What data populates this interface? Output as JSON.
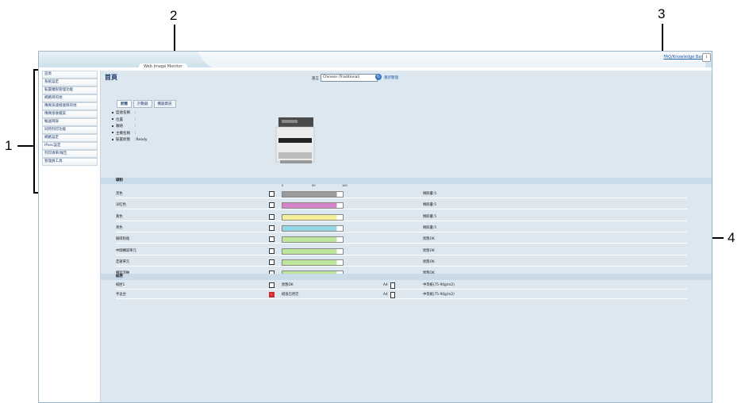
{
  "callouts": {
    "c1": "1",
    "c2": "2",
    "c3": "3",
    "c4": "4"
  },
  "header": {
    "brand": "Web Image Monitor",
    "faq": "FAQ/Knowledge Base",
    "help_icon": "help-icon"
  },
  "sidebar": {
    "items": [
      "首頁",
      "系統設定",
      "裝置權限管理功能",
      "網路目的地",
      "傳真快速撥號目的地",
      "傳真接收檔案",
      "輸送目錄",
      "同時列印功能",
      "網路設定",
      "IPsec設定",
      "列印清單/報告",
      "管理員工具"
    ]
  },
  "main": {
    "title": "首頁",
    "language_label": "語言",
    "language_value": "Chinese (Traditional)",
    "refresh_label": "重新整理",
    "tabs": [
      "狀態",
      "計數器",
      "機器資訊"
    ],
    "info": [
      {
        "label": "型號名稱",
        "value": ":"
      },
      {
        "label": "位置",
        "value": ":"
      },
      {
        "label": "聯絡",
        "value": ":"
      },
      {
        "label": "主機名稱",
        "value": ":"
      },
      {
        "label": "裝置狀態",
        "value": ":Ready"
      }
    ],
    "toner_section": "碳粉",
    "scale": [
      "0",
      "50",
      "100"
    ],
    "toner": [
      {
        "name": "黑色",
        "status": "剩餘量:5",
        "color": "#9a9a9a",
        "level": 0.9
      },
      {
        "name": "洋紅色",
        "status": "剩餘量:5",
        "color": "#d486c9",
        "level": 0.9
      },
      {
        "name": "黃色",
        "status": "剩餘量:5",
        "color": "#f4ef98",
        "level": 0.9
      },
      {
        "name": "青色",
        "status": "剩餘量:5",
        "color": "#93d7e6",
        "level": 0.9
      },
      {
        "name": "廢碳粉瓶",
        "status": "狀態OK",
        "color": "#bde59b",
        "level": 0.9
      },
      {
        "name": "中間轉寫單元",
        "status": "狀態OK",
        "color": "#bde59b",
        "level": 0.9
      },
      {
        "name": "定著單元",
        "status": "狀態OK",
        "color": "#bde59b",
        "level": 0.9
      },
      {
        "name": "轉寫滾軸",
        "status": "狀態OK",
        "color": "#bde59b",
        "level": 0.9
      }
    ],
    "paper_section": "紙匣",
    "paper": [
      {
        "name": "紙匣1",
        "status": "狀態OK",
        "size": "A4",
        "type": "中等紙(75-90g/m2)",
        "alert": false
      },
      {
        "name": "手送台",
        "status": "紙張已用完",
        "size": "A4",
        "type": "中等紙(75-90g/m2)",
        "alert": true
      }
    ]
  }
}
